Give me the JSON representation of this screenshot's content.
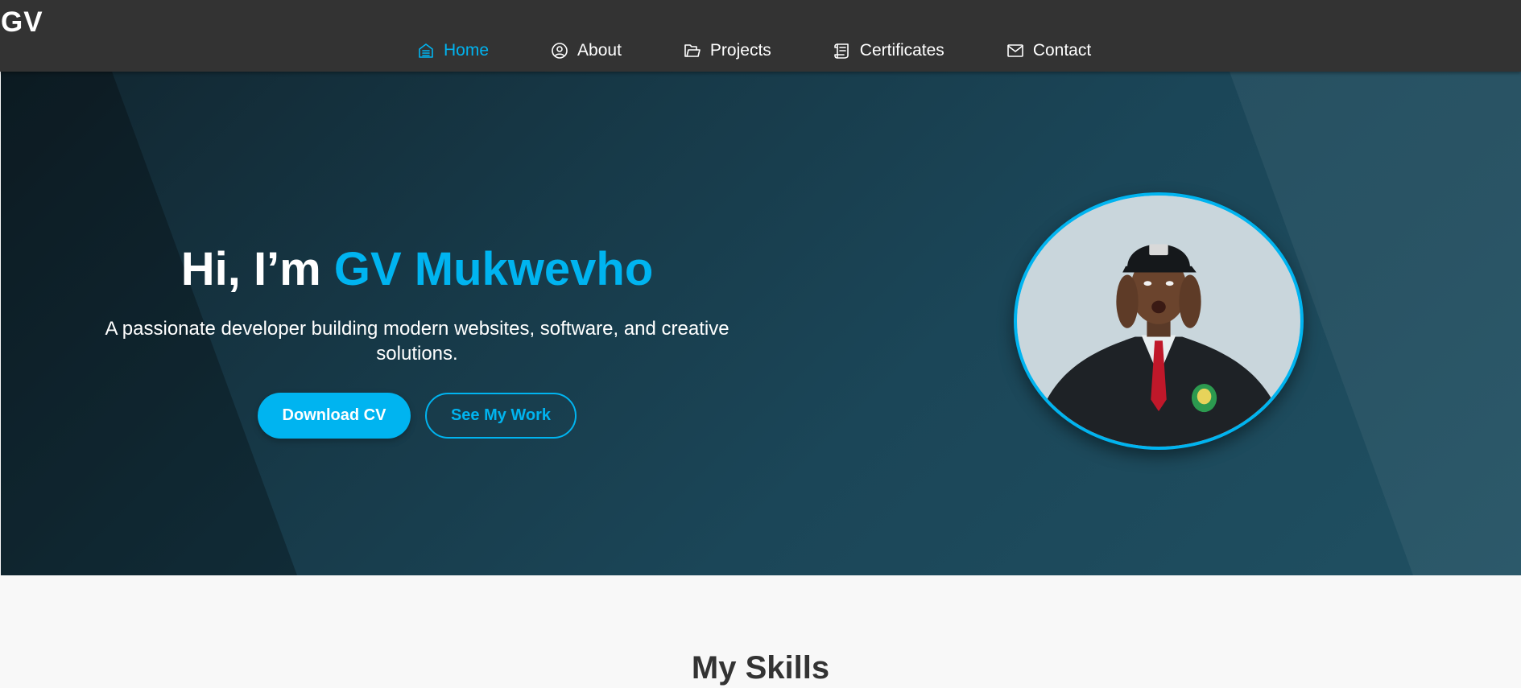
{
  "brand": {
    "logo": "GV"
  },
  "nav": {
    "items": [
      {
        "label": "Home",
        "icon": "home-icon",
        "active": true
      },
      {
        "label": "About",
        "icon": "user-circle-icon",
        "active": false
      },
      {
        "label": "Projects",
        "icon": "folder-icon",
        "active": false
      },
      {
        "label": "Certificates",
        "icon": "scroll-icon",
        "active": false
      },
      {
        "label": "Contact",
        "icon": "mail-icon",
        "active": false
      }
    ]
  },
  "hero": {
    "greeting": "Hi, I’m ",
    "name": "GV Mukwevho",
    "subtitle": "A passionate developer building modern websites, software, and creative solutions.",
    "primary_button": "Download CV",
    "secondary_button": "See My Work",
    "avatar_alt": "profile-photo"
  },
  "skills": {
    "title": "My Skills"
  },
  "colors": {
    "accent": "#00b4f0",
    "navbar": "#333333",
    "hero_dark": "#11252f",
    "hero_light": "#205062"
  }
}
